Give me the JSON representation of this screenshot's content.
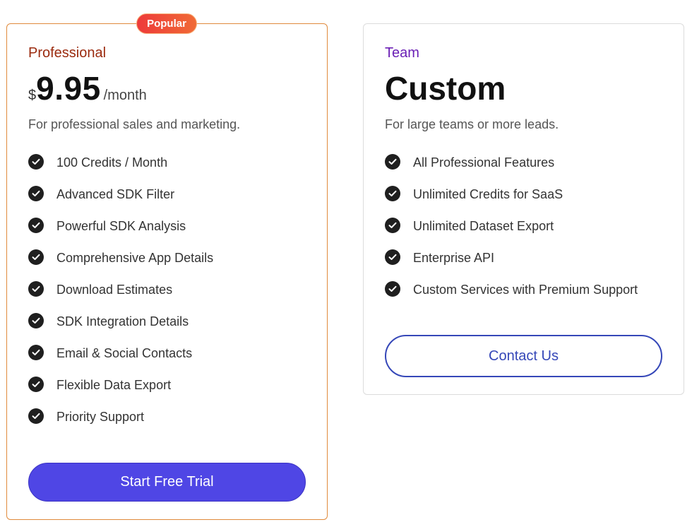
{
  "professional": {
    "badge": "Popular",
    "name": "Professional",
    "currency": "$",
    "amount": "9.95",
    "period": "/month",
    "description": "For professional sales and marketing.",
    "features": [
      "100 Credits / Month",
      "Advanced SDK Filter",
      "Powerful SDK Analysis",
      "Comprehensive App Details",
      "Download Estimates",
      "SDK Integration Details",
      "Email & Social Contacts",
      "Flexible Data Export",
      "Priority Support"
    ],
    "cta": "Start Free Trial"
  },
  "team": {
    "name": "Team",
    "price": "Custom",
    "description": "For large teams or more leads.",
    "features": [
      "All Professional Features",
      "Unlimited Credits for SaaS",
      "Unlimited Dataset Export",
      "Enterprise API",
      "Custom Services with Premium Support"
    ],
    "cta": "Contact Us"
  },
  "icons": {
    "feature": "check-circle-icon"
  },
  "colors": {
    "primary_button": "#4f46e5",
    "outline_button": "#3547b8",
    "pro_border": "#e08a3c",
    "pro_name": "#9b2b0f",
    "team_name": "#6a1fb5",
    "badge_start": "#ee3a3a",
    "badge_end": "#f06a35"
  }
}
